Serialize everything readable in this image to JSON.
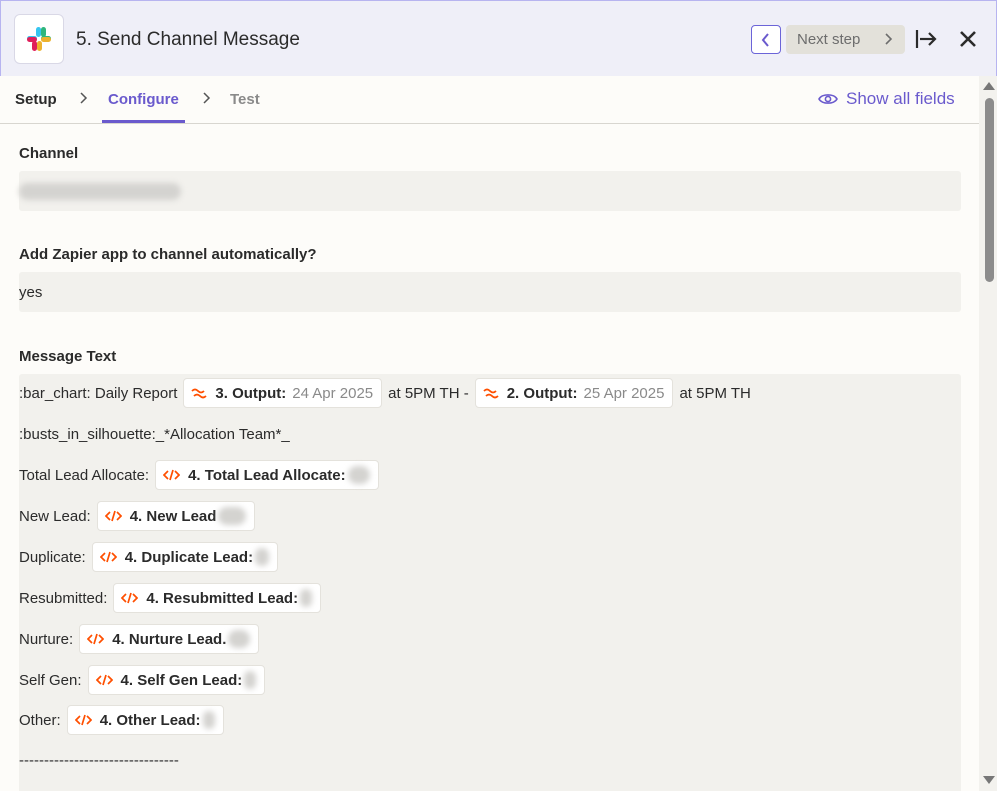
{
  "header": {
    "title": "5. Send Channel Message",
    "next_label": "Next step",
    "app_icon": "slack-logo",
    "prev_icon": "chevron-left-icon",
    "collapse_icon": "collapse-right-icon",
    "close_icon": "close-icon"
  },
  "tabs": [
    {
      "label": "Setup"
    },
    {
      "label": "Configure",
      "active": true
    },
    {
      "label": "Test"
    }
  ],
  "show_fields_label": "Show all fields",
  "fields": {
    "channel": {
      "label": "Channel"
    },
    "auto_add": {
      "label": "Add Zapier app to channel automatically?",
      "value": "yes"
    },
    "message": {
      "label": "Message Text"
    }
  },
  "message_lines": {
    "line1": {
      "prefix": ":bar_chart: Daily Report",
      "pill1": {
        "label": "3. Output:",
        "value": "24 Apr 2025"
      },
      "middle": "at 5PM TH -",
      "pill2": {
        "label": "2. Output:",
        "value": "25 Apr 2025"
      },
      "suffix": "at 5PM TH"
    },
    "line2": ":busts_in_silhouette:_*Allocation Team*_",
    "rows": [
      {
        "text": "Total Lead Allocate:",
        "pill": "4. Total Lead Allocate:"
      },
      {
        "text": "New Lead:",
        "pill": "4. New Lead"
      },
      {
        "text": "Duplicate:",
        "pill": "4. Duplicate Lead:"
      },
      {
        "text": "Resubmitted:",
        "pill": "4. Resubmitted Lead:"
      },
      {
        "text": "Nurture:",
        "pill": "4. Nurture Lead."
      },
      {
        "text": "Self Gen:",
        "pill": "4. Self Gen Lead:"
      },
      {
        "text": "Other:",
        "pill": "4. Other Lead:"
      }
    ],
    "divider": "--------------------------------"
  },
  "colors": {
    "accent": "#6a5acd",
    "header_bg": "#efeff8",
    "field_bg": "#f2f1ed",
    "pill_icon": "#ff4f00"
  }
}
